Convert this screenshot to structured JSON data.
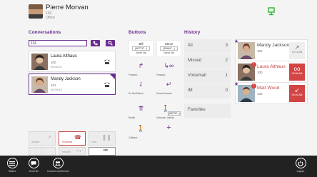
{
  "header": {
    "name": "Pierre Morvan",
    "extension": "102",
    "status": "Office"
  },
  "conversations": {
    "title": "Conversations",
    "search_value": "101",
    "items": [
      {
        "name": "Laura Althaus",
        "number": "100",
        "time": "00:00:02"
      },
      {
        "name": "Mandy Jackson",
        "number": "101",
        "time": "00:00:43"
      }
    ]
  },
  "controls": {
    "row1": [
      {
        "label": "Answer",
        "icon": "answer-icon"
      },
      {
        "label": "Terminate",
        "icon": "hangup-icon"
      },
      {
        "label": "Hold",
        "icon": "pause-icon"
      }
    ],
    "row2": [
      {
        "label": "",
        "icon": "keypad-icon"
      },
      {
        "label": "Transfer",
        "icon": "transfer-icon"
      },
      {
        "label": "",
        "icon": "more-icon",
        "glyph": "•••"
      }
    ]
  },
  "buttons": {
    "title": "Buttons",
    "items": [
      {
        "name": "Bill",
        "number": "(987737...)",
        "label": "Speed dial"
      },
      {
        "name": "Steve",
        "number": "(336697...)",
        "label": "Speed dial"
      },
      {
        "label": "Forward..."
      },
      {
        "label": "Forward..."
      },
      {
        "label": "Do Not Disturb"
      },
      {
        "label": "Cancel forward"
      },
      {
        "label": "Redial"
      },
      {
        "label": "Unknown: Intrude",
        "number": "(987737...)"
      },
      {
        "label": "Callback..."
      },
      {
        "label": ""
      }
    ]
  },
  "history": {
    "title": "History",
    "filters": [
      {
        "label": "All",
        "count": "3"
      },
      {
        "label": "Missed",
        "count": "2"
      },
      {
        "label": "Voicemail",
        "count": "1"
      },
      {
        "label": "IM",
        "count": "0"
      },
      {
        "label": "Favorites",
        "count": ""
      }
    ],
    "items": [
      {
        "name": "Mandy Jackson",
        "ext": "101",
        "time": "10:11 AM",
        "missed": false
      },
      {
        "name": "Laura Althaus",
        "ext": "100",
        "time": "09:56 AM",
        "missed": true
      },
      {
        "name": "Matt Wood",
        "ext": "103",
        "time": "09:46 AM",
        "missed": true
      }
    ]
  },
  "appbar": {
    "status": "Status",
    "send_im": "Send IM",
    "conference": "Convert conference",
    "logout": "Logout"
  },
  "colors": {
    "accent": "#6a2c91",
    "danger": "#d24545",
    "appbar": "#222222",
    "network": "#2db42d"
  }
}
